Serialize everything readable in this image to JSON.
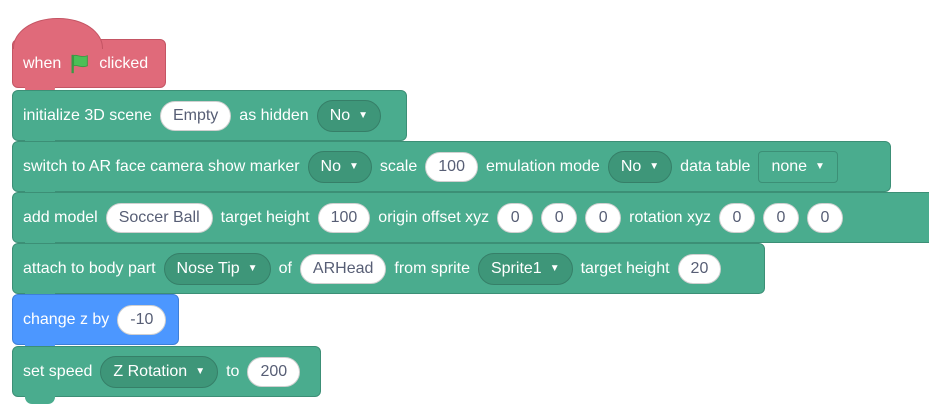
{
  "blocks": {
    "when": {
      "pre": "when",
      "post": "clicked",
      "flag_icon": "green-flag-icon"
    },
    "init": {
      "text1": "initialize 3D scene",
      "scene": "Empty",
      "text2": "as hidden",
      "hidden": "No"
    },
    "ar": {
      "text1": "switch to AR face camera show marker",
      "marker": "No",
      "text2": "scale",
      "scale": "100",
      "text3": "emulation mode",
      "emulation": "No",
      "text4": "data table",
      "table": "none"
    },
    "model": {
      "text1": "add model",
      "model": "Soccer Ball",
      "text2": "target height",
      "height": "100",
      "text3": "origin offset xyz",
      "ox": "0",
      "oy": "0",
      "oz": "0",
      "text4": "rotation xyz",
      "rx": "0",
      "ry": "0",
      "rz": "0"
    },
    "attach": {
      "text1": "attach to body part",
      "part": "Nose Tip",
      "text2": "of",
      "target": "ARHead",
      "text3": "from sprite",
      "sprite": "Sprite1",
      "text4": "target height",
      "height": "20"
    },
    "changez": {
      "text1": "change z by",
      "value": "-10"
    },
    "speed": {
      "text1": "set speed",
      "prop": "Z Rotation",
      "text2": "to",
      "value": "200"
    }
  },
  "colors": {
    "teal": "#4aac8e",
    "blue": "#4c97ff",
    "hat": "#e06a7a",
    "flag": "#4cbf56"
  }
}
